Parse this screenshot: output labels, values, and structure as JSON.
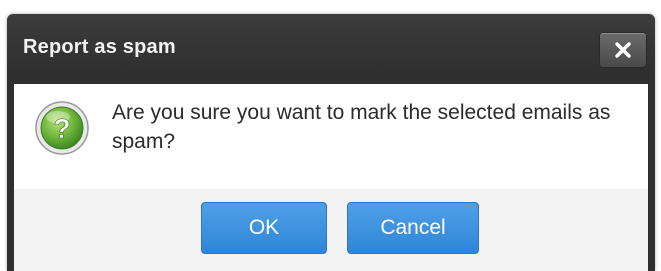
{
  "dialog": {
    "title": "Report as spam",
    "close_icon": "close-icon",
    "message": "Are you sure you want to mark the selected emails as spam?",
    "message_icon": "question-icon",
    "buttons": {
      "ok_label": "OK",
      "cancel_label": "Cancel"
    }
  },
  "colors": {
    "titlebar": "#2f2f2f",
    "button_primary": "#3a8fdd",
    "icon_green": "#6cb43c"
  }
}
